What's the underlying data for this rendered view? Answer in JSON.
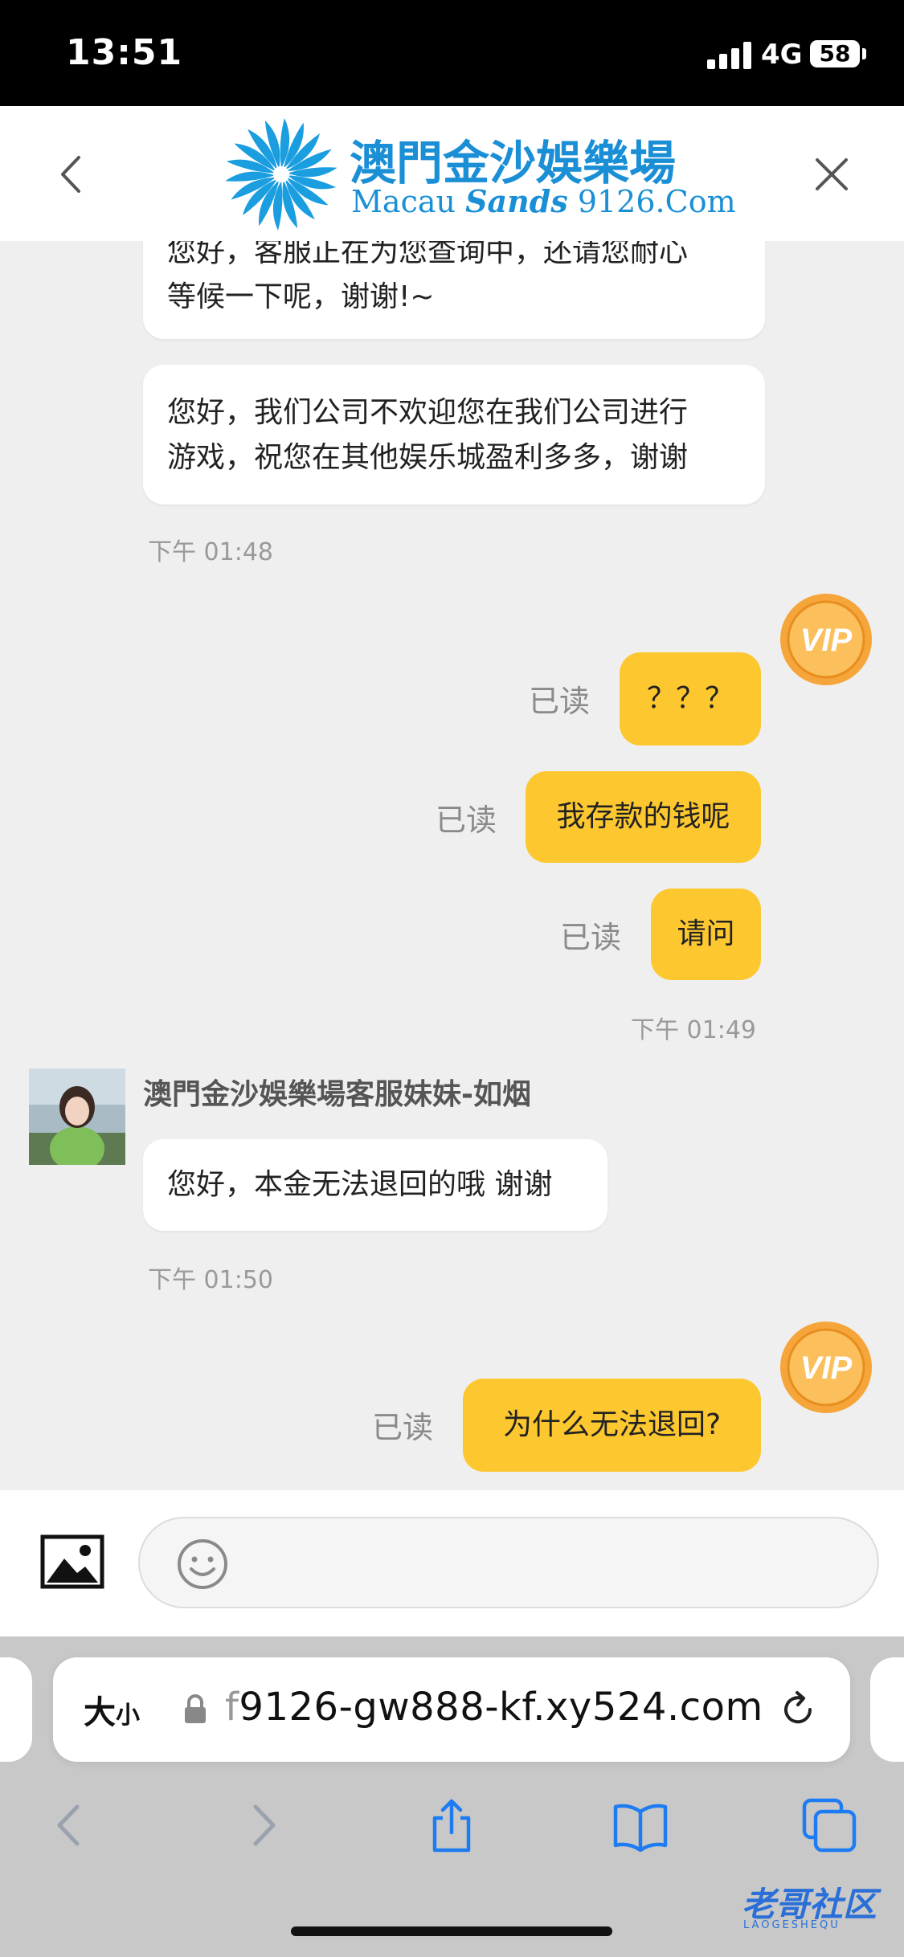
{
  "status_bar": {
    "time": "13:51",
    "network": "4G",
    "battery": "58"
  },
  "header": {
    "logo_title": "澳門金沙娛樂場",
    "logo_sub_prefix": "Macau",
    "logo_sub_brand": "Sands",
    "logo_sub_suffix": "9126.Com"
  },
  "chat": {
    "msg1_line1": "您好，客服正在为您查询中，还请您耐心",
    "msg1_line2": "等候一下呢，谢谢!~",
    "msg2_line1": "您好，我们公司不欢迎您在我们公司进行",
    "msg2_line2": "游戏，祝您在其他娱乐城盈利多多，谢谢",
    "time1": "下午 01:48",
    "out1": "？？？",
    "out1_status": "已读",
    "out2": "我存款的钱呢",
    "out2_status": "已读",
    "out3": "请问",
    "out3_status": "已读",
    "time2": "下午 01:49",
    "agent_name": "澳門金沙娛樂場客服妹妹-如烟",
    "in3": "您好，本金无法退回的哦 谢谢",
    "time3": "下午 01:50",
    "out4": "为什么无法退回?",
    "out4_status": "已读",
    "vip_label": "VIP"
  },
  "browser": {
    "text_size_big": "大",
    "text_size_small": "小",
    "url_dim": "f",
    "url_rest": "9126-gw888-kf.xy524.com"
  },
  "watermark": {
    "text": "老哥社区",
    "sub": "LAOGESHEQU"
  },
  "colors": {
    "accent_yellow": "#fdc82f",
    "logo_blue": "#1a8fd6",
    "ios_blue": "#1e7cf2"
  }
}
